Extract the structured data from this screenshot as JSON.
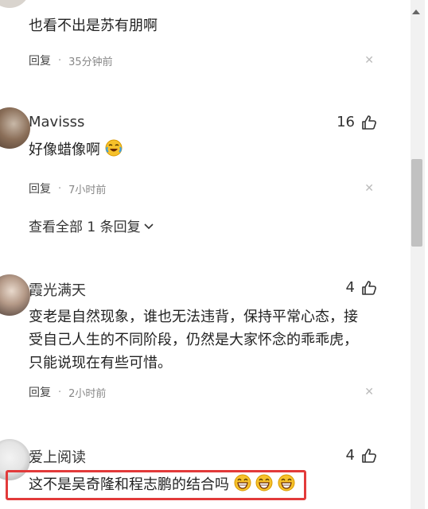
{
  "comments": [
    {
      "id": "c0",
      "text": "也看不出是苏有朋啊",
      "reply_label": "回复",
      "separator": "·",
      "time": "35分钟前"
    },
    {
      "id": "c1",
      "username": "Mavisss",
      "likes": "16",
      "text": "好像蜡像啊",
      "emoji": "crying-laughing-emoji",
      "reply_label": "回复",
      "separator": "·",
      "time": "7小时前",
      "view_all": "查看全部 1 条回复"
    },
    {
      "id": "c2",
      "username": "霞光满天",
      "likes": "4",
      "text_lines": [
        "变老是自然现象，谁也无法违背，保持平常心态，接",
        "受自己人生的不同阶段，仍然是大家怀念的乖乖虎，",
        "只能说现在有些可惜。"
      ],
      "reply_label": "回复",
      "separator": "·",
      "time": "2小时前"
    },
    {
      "id": "c3",
      "username": "爱上阅读",
      "likes": "4",
      "text": "这不是吴奇隆和程志鹏的结合吗",
      "emoji": "grinning-face-emoji",
      "emoji_count": 3
    }
  ],
  "colors": {
    "highlight_border": "#e23a3a",
    "emoji_yellow": "#f6c12a"
  }
}
